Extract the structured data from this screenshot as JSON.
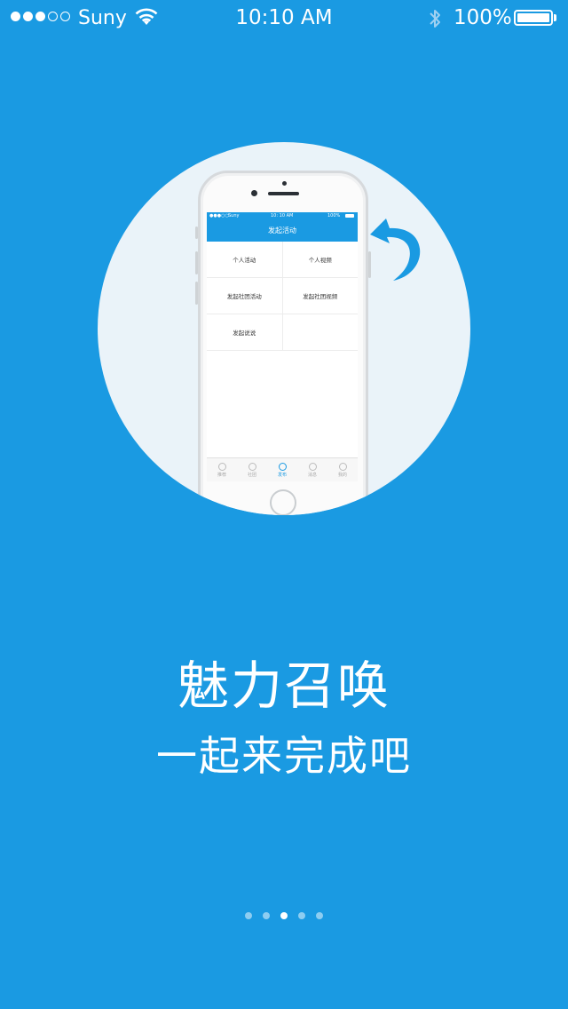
{
  "status_bar": {
    "signal_dots_filled": 3,
    "signal_dots_total": 5,
    "carrier": "Suny",
    "time": "10:10 AM",
    "battery_percent_text": "100%",
    "battery_level": 1.0
  },
  "illustration": {
    "mini_status": {
      "carrier": "Suny",
      "time": "10: 10 AM",
      "battery": "100%"
    },
    "mini_nav_title": "发起活动",
    "mini_grid": [
      [
        "个人活动",
        "个人视频"
      ],
      [
        "发起社团活动",
        "发起社团视频"
      ],
      [
        "发起说说",
        ""
      ]
    ],
    "mini_tabs": [
      {
        "label": "推荐",
        "active": false
      },
      {
        "label": "社团",
        "active": false
      },
      {
        "label": "发布",
        "active": true
      },
      {
        "label": "消息",
        "active": false
      },
      {
        "label": "我的",
        "active": false
      }
    ]
  },
  "headline": "魅力召唤",
  "subline": "一起来完成吧",
  "pager": {
    "count": 5,
    "active_index": 2
  },
  "colors": {
    "background": "#1a9ae2",
    "circle": "#eaf3f9",
    "accent": "#1a9ae2"
  }
}
